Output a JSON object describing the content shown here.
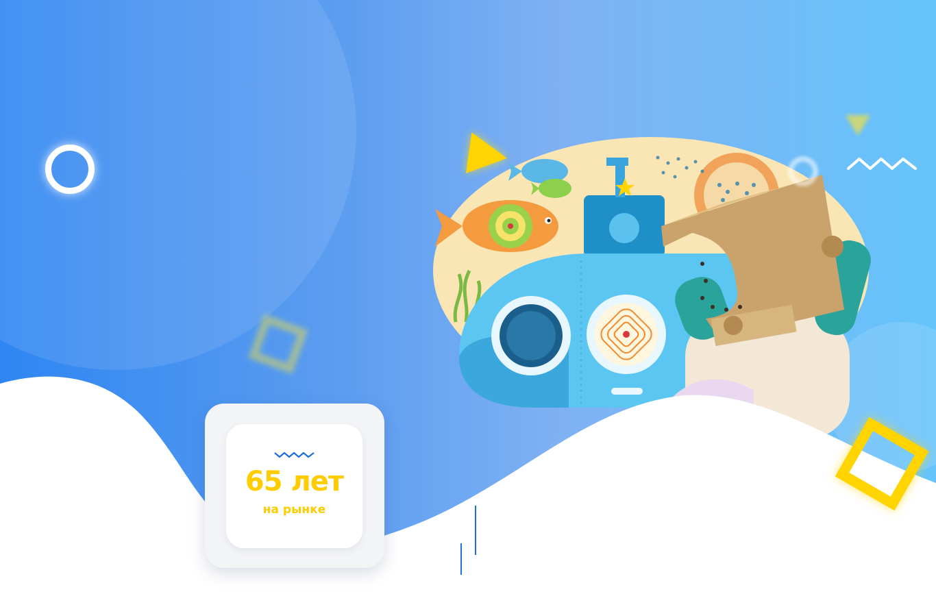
{
  "badge": {
    "number_text": "65 лет",
    "caption": "на рынке"
  },
  "colors": {
    "accent_yellow": "#ffd400",
    "badge_text": "#ffcc00",
    "brand_blue": "#1d6fe0",
    "background_gradient_start": "#2f86f2",
    "background_gradient_end": "#66c4fb"
  },
  "decorations": {
    "icons": [
      "ring-icon",
      "triangle-icon",
      "zigzag-icon",
      "square-icon"
    ]
  }
}
